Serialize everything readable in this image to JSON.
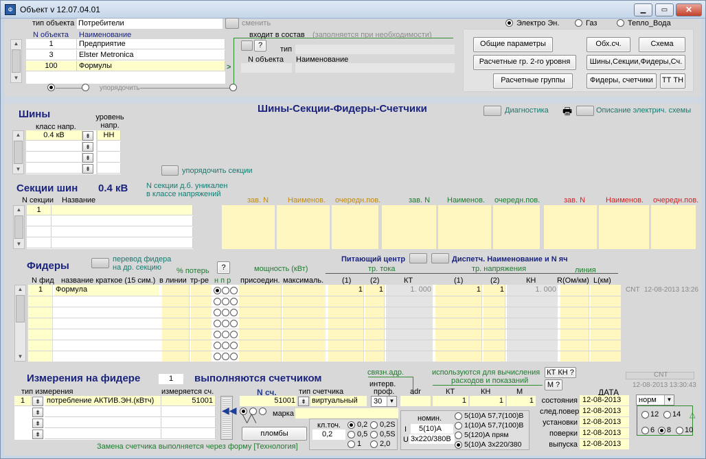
{
  "window": {
    "title": "Объект  v 12.07.04.01",
    "min": "▁",
    "max": "▭",
    "close": "✕"
  },
  "top": {
    "type_label": "тип объекта",
    "type_value": "Потребители",
    "change_btn": "сменить",
    "col_n": "N объекта",
    "col_name": "Наименование",
    "rows": [
      {
        "n": "1",
        "name": "Предприятие"
      },
      {
        "n": "3",
        "name": "Elster Metronica"
      },
      {
        "n": "100",
        "name": "Формулы"
      }
    ],
    "order": "упорядочить",
    "arrow": ">",
    "part_label": "входит в состав",
    "part_hint": "(заполняется при необходимости)",
    "q": "?",
    "tip": "тип",
    "part_n": "N объекта",
    "part_name": "Наименование"
  },
  "energy": {
    "opt1": "Электро Эн.",
    "opt2": "Газ",
    "opt3": "Тепло_Вода"
  },
  "buttons": {
    "general": "Общие параметры",
    "calc2": "Расчетные гр. 2-го уровня",
    "calc": "Расчетные группы",
    "obsch": "Обх.сч.",
    "scheme": "Схема",
    "buses": "Шины,Секции,Фидеры,Сч.",
    "feeders": "Фидеры, счетчики",
    "tttn": "ТТ ТН"
  },
  "mid": {
    "title": "Шины-Секции-Фидеры-Счетчики",
    "diag": "Диагностика",
    "desc": "Описание электрич. схемы",
    "printer": "🖶"
  },
  "buses": {
    "title": "Шины",
    "class_label": "класс напр.",
    "level_label": "уровень напр.",
    "class_value": "0.4 кВ",
    "level_value": "НН",
    "sort_sections": "упорядочить секции",
    "dd": "⇟"
  },
  "sections": {
    "title": "Секции шин",
    "kv": "0.4 кВ",
    "note1": "N секции д.б. уникален",
    "note2": "в классе  напряжений",
    "col_n": "N секции",
    "col_name": "Название",
    "row_n": "1",
    "grp": [
      {
        "a": "зав. N",
        "b": "Наименов.",
        "c": "очередн.пов."
      },
      {
        "a": "зав. N",
        "b": "Наименов.",
        "c": "очередн.пов."
      },
      {
        "a": "зав. N",
        "b": "Наименов.",
        "c": "очередн.пов."
      }
    ]
  },
  "feeders": {
    "title": "Фидеры",
    "transfer1": "перевод фидера",
    "transfer2": "на др. секцию",
    "loss": "% потерь",
    "q": "?",
    "power": "мощность (кВт)",
    "feed": "Питающий центр",
    "disp": "Диспетч. Наименование и N яч",
    "tt": "тр. тока",
    "tn": "тр. напряжения",
    "line": "линия",
    "col_n": "N фид",
    "col_name": "название краткое (15 сим.)",
    "col_inline": "в линии",
    "col_trre": "тр-ре",
    "col_npr": "н  п  р",
    "col_pris": "присоедин.",
    "col_max": "максималь.",
    "col_1": "(1)",
    "col_2": "(2)",
    "col_kt": "КТ",
    "col_1b": "(1)",
    "col_2b": "(2)",
    "col_kn": "КН",
    "col_r": "R(Ом/км)",
    "col_l": "L(км)",
    "row": {
      "n": "1",
      "name": "Формула",
      "tt1": "1",
      "tt2": "1",
      "kt": "1. 000",
      "tn1": "1",
      "tn2": "1",
      "kn": "1. 000"
    },
    "cnt": "CNT",
    "cnt_date": "12-08-2013 13:26"
  },
  "meas": {
    "title": "Измерения на фидере",
    "fid": "1",
    "subtitle": "выполняются счетчиком",
    "type_label": "тип измерения",
    "meas_label": "измеряется сч.",
    "row_n": "1",
    "row_type": "потребление АКТИВ.ЭН.(кВтч)",
    "row_val": "51001",
    "nsc_label": "N сч.",
    "nsc": "51001",
    "tsc_label": "тип счетчика",
    "tsc": "виртуальный",
    "mark": "марка",
    "seals": "пломбы",
    "link": "связн.адр.",
    "interval1": "интерв.",
    "interval2": "проф.",
    "interval": "30",
    "adr": "adr",
    "used1": "используются для вычисления",
    "used2": "расходов и показаний",
    "kt_btn": "КТ КН ?",
    "m_btn": "М ?",
    "kt": "КТ",
    "kn": "КН",
    "m": "М",
    "kt_v": "1",
    "kn_v": "1",
    "m_v": "1",
    "klt_label": "кл.точ.",
    "klt_val": "0,2",
    "klt": [
      "0,2",
      "0,2S",
      "0,5",
      "0,5S",
      "1",
      "2,0"
    ],
    "nom_label": "номин.",
    "nom_i_lbl": "I",
    "nom_i": "5(10)А",
    "nom_u_lbl": "U",
    "nom_u": "3х220/380В",
    "nomopts": [
      "5(10)А 57,7(100)В",
      "1(10)А 57,7(100)В",
      "5(120)А прям",
      "5(10)А 3х220/380"
    ],
    "replace": "Замена счетчика выполняется через форму [Технология]",
    "cnt": "CNT",
    "cnt_date": "12-08-2013 13:30:43",
    "date_hdr": "ДАТА",
    "dates": [
      {
        "l": "состояния",
        "v": "12-08-2013"
      },
      {
        "l": "след.повер.",
        "v": "12-08-2013"
      },
      {
        "l": "установки",
        "v": "12-08-2013"
      },
      {
        "l": "поверки",
        "v": "12-08-2013"
      },
      {
        "l": "выпуска",
        "v": "12-08-2013"
      }
    ],
    "state": "норм",
    "periods": [
      "12",
      "14",
      "6",
      "8",
      "10"
    ]
  }
}
